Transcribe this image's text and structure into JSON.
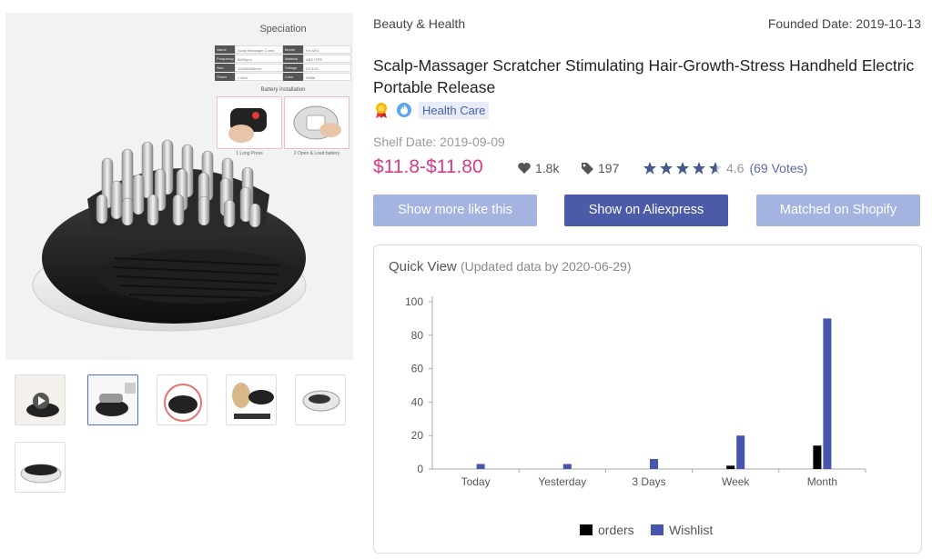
{
  "gallery": {
    "spec_title": "Speciation",
    "spec_rows": [
      [
        "Name",
        "Scalp Massager Comb",
        "Model",
        "KH-M01"
      ],
      [
        "Frequency",
        "8000rpm",
        "Material",
        "ABS+TPE"
      ],
      [
        "Size",
        "110x80x60mm",
        "Voltage",
        "DC3.0V"
      ],
      [
        "Power",
        "2 AAA",
        "Color",
        "White"
      ]
    ],
    "battery_title": "Battery installation",
    "battery_steps": [
      "1 Long Press",
      "2 Open & Load battery"
    ]
  },
  "product": {
    "category": "Beauty & Health",
    "founded": "Founded Date: 2019-10-13",
    "title": "Scalp-Massager Scratcher Stimulating Hair-Growth-Stress Handheld Electric Portable Release",
    "tag": "Health Care",
    "shelf_date": "Shelf Date: 2019-09-09",
    "price": "$11.8-$11.80",
    "likes": "1.8k",
    "orders": "197",
    "rating": 4.6,
    "rating_text": "4.6",
    "votes": "(69 Votes)"
  },
  "buttons": {
    "more": "Show more like this",
    "aliexpress": "Show on Aliexpress",
    "shopify": "Matched on Shopify"
  },
  "quick_view": {
    "title": "Quick View",
    "subtitle": "(Updated data by 2020-06-29)"
  },
  "colors": {
    "orders": "#000000",
    "wishlist": "#4655ad",
    "price": "#d93b87",
    "button_light": "#a4b3e0",
    "button_dark": "#4b5ba8"
  },
  "chart_data": {
    "type": "bar",
    "categories": [
      "Today",
      "Yesterday",
      "3 Days",
      "Week",
      "Month"
    ],
    "series": [
      {
        "name": "orders",
        "values": [
          0,
          0,
          0,
          2,
          14
        ]
      },
      {
        "name": "Wishlist",
        "values": [
          3,
          3,
          6,
          20,
          90
        ]
      }
    ],
    "yticks": [
      0,
      20,
      40,
      60,
      80,
      100
    ],
    "ylim": [
      0,
      100
    ],
    "legend": "bottom-center",
    "grid": false
  }
}
